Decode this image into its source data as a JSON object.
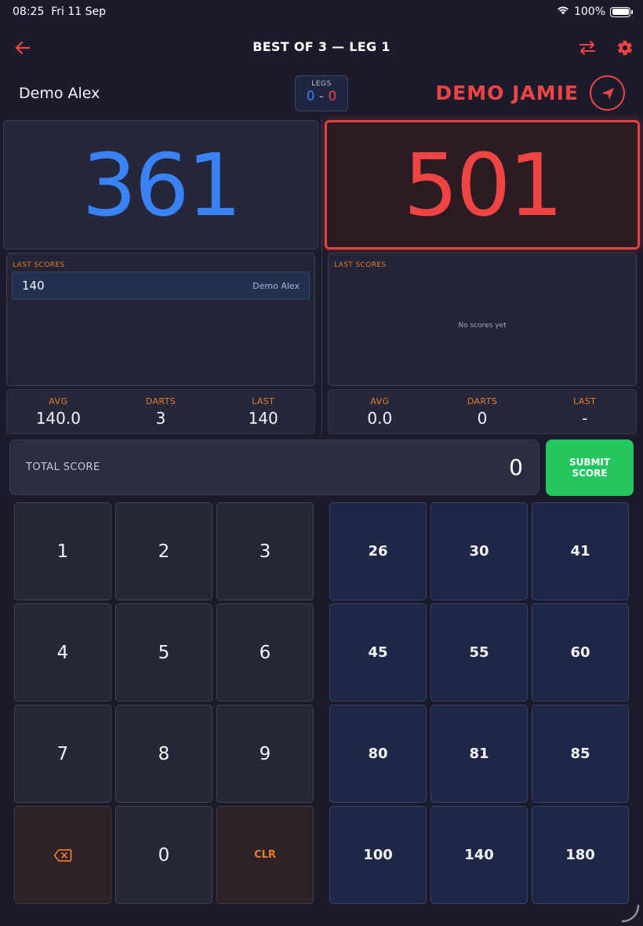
{
  "status_bar": {
    "time": "08:25",
    "date": "Fri 11 Sep",
    "battery": "100%",
    "wifi_icon": "wifi-icon",
    "battery_icon": "battery-icon"
  },
  "header": {
    "title": "BEST OF 3 — LEG 1",
    "back_icon": "arrow-left-icon",
    "swap_icon": "swap-arrows-icon",
    "settings_icon": "gear-icon"
  },
  "colors": {
    "player1": "#3b82f6",
    "player2": "#ef4444",
    "accent_orange": "#e87c2b",
    "submit_green": "#22c55e"
  },
  "legs": {
    "label": "LEGS",
    "player1": "0",
    "separator": "-",
    "player2": "0"
  },
  "player1": {
    "name": "Demo Alex",
    "remaining": "361",
    "last_scores_label": "LAST SCORES",
    "last_scores": [
      {
        "score": "140",
        "player": "Demo Alex"
      }
    ],
    "stats": [
      {
        "label": "AVG",
        "value": "140.0"
      },
      {
        "label": "DARTS",
        "value": "3"
      },
      {
        "label": "LAST",
        "value": "140"
      }
    ]
  },
  "player2": {
    "name": "DEMO JAMIE",
    "remaining": "501",
    "active": true,
    "throw_icon": "arrow-pointer-icon",
    "last_scores_label": "LAST SCORES",
    "empty_text": "No scores yet",
    "stats": [
      {
        "label": "AVG",
        "value": "0.0"
      },
      {
        "label": "DARTS",
        "value": "0"
      },
      {
        "label": "LAST",
        "value": "-"
      }
    ]
  },
  "input": {
    "label": "TOTAL SCORE",
    "value": "0",
    "submit_label": "SUBMIT SCORE"
  },
  "keypad": {
    "rows": [
      [
        "1",
        "2",
        "3"
      ],
      [
        "4",
        "5",
        "6"
      ],
      [
        "7",
        "8",
        "9"
      ],
      [
        "",
        "0",
        "CLR"
      ]
    ],
    "backspace_icon": "backspace-icon"
  },
  "presets": {
    "rows": [
      [
        "26",
        "30",
        "41"
      ],
      [
        "45",
        "55",
        "60"
      ],
      [
        "80",
        "81",
        "85"
      ],
      [
        "100",
        "140",
        "180"
      ]
    ]
  }
}
